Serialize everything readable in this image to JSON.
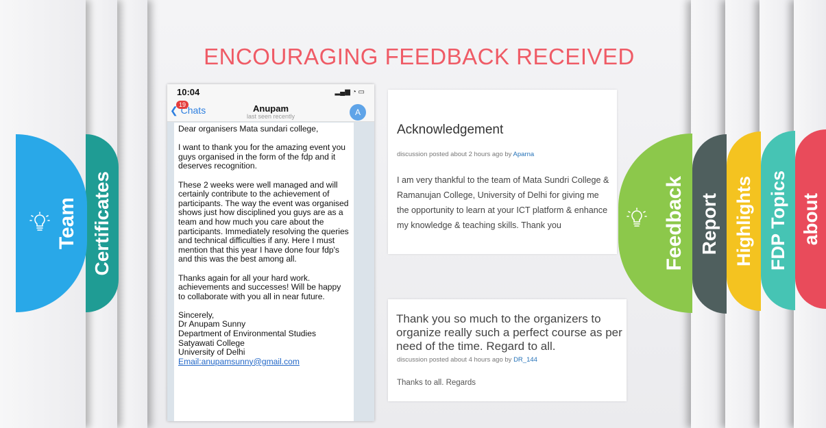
{
  "title": "ENCOURAGING FEEDBACK RECEIVED",
  "left_tabs": [
    {
      "label": "Team",
      "color": "#29a8e8"
    },
    {
      "label": "Certificates",
      "color": "#1f9c94"
    }
  ],
  "right_tabs": [
    {
      "label": "Feedback",
      "color": "#8cc84b"
    },
    {
      "label": "Report",
      "color": "#4f5f5e"
    },
    {
      "label": "Highlights",
      "color": "#f4c320"
    },
    {
      "label": "FDP Topics",
      "color": "#46c4b4"
    },
    {
      "label": "about",
      "color": "#e94b5b"
    }
  ],
  "phone": {
    "time": "10:04",
    "back": "Chats",
    "badge": "19",
    "contact": "Anupam",
    "contact_status": "last seen recently",
    "avatar": "A",
    "message": "Dear organisers Mata sundari college,\n\nI want to thank you for the amazing event you guys organised in the form of the fdp and it deserves recognition.\n\nThese 2 weeks were well managed and will certainly  contribute to the achievement of participants. The way the event was organised shows just how disciplined you guys are as a team and how much you care about the participants. Immediately resolving the queries and technical difficulties if any. Here I must mention that this year I have done four fdp's and this was the best among all.\n\n Thanks again for all your hard work. achievements and successes! Will be happy to collaborate with you all in near future.\n\nSincerely,\nDr Anupam Sunny\nDepartment of Environmental Studies\nSatyawati College\nUniversity of Delhi",
    "email": "Email:anupamsunny@gmail.com"
  },
  "card1": {
    "title": "Acknowledgement",
    "meta_prefix": "discussion posted about 2 hours ago by ",
    "author": "Aparna",
    "body": "I am very thankful to the team of Mata Sundri College & Ramanujan College, University of Delhi for giving me the opportunity to learn at your ICT platform & enhance my knowledge & teaching skills. Thank you"
  },
  "card2": {
    "title": "Thank you so much to the organizers to organize really such a perfect course as per need of the time. Regard to all.",
    "meta_prefix": "discussion posted about 4 hours ago by ",
    "author": "DR_144",
    "body": "Thanks to all. Regards"
  }
}
